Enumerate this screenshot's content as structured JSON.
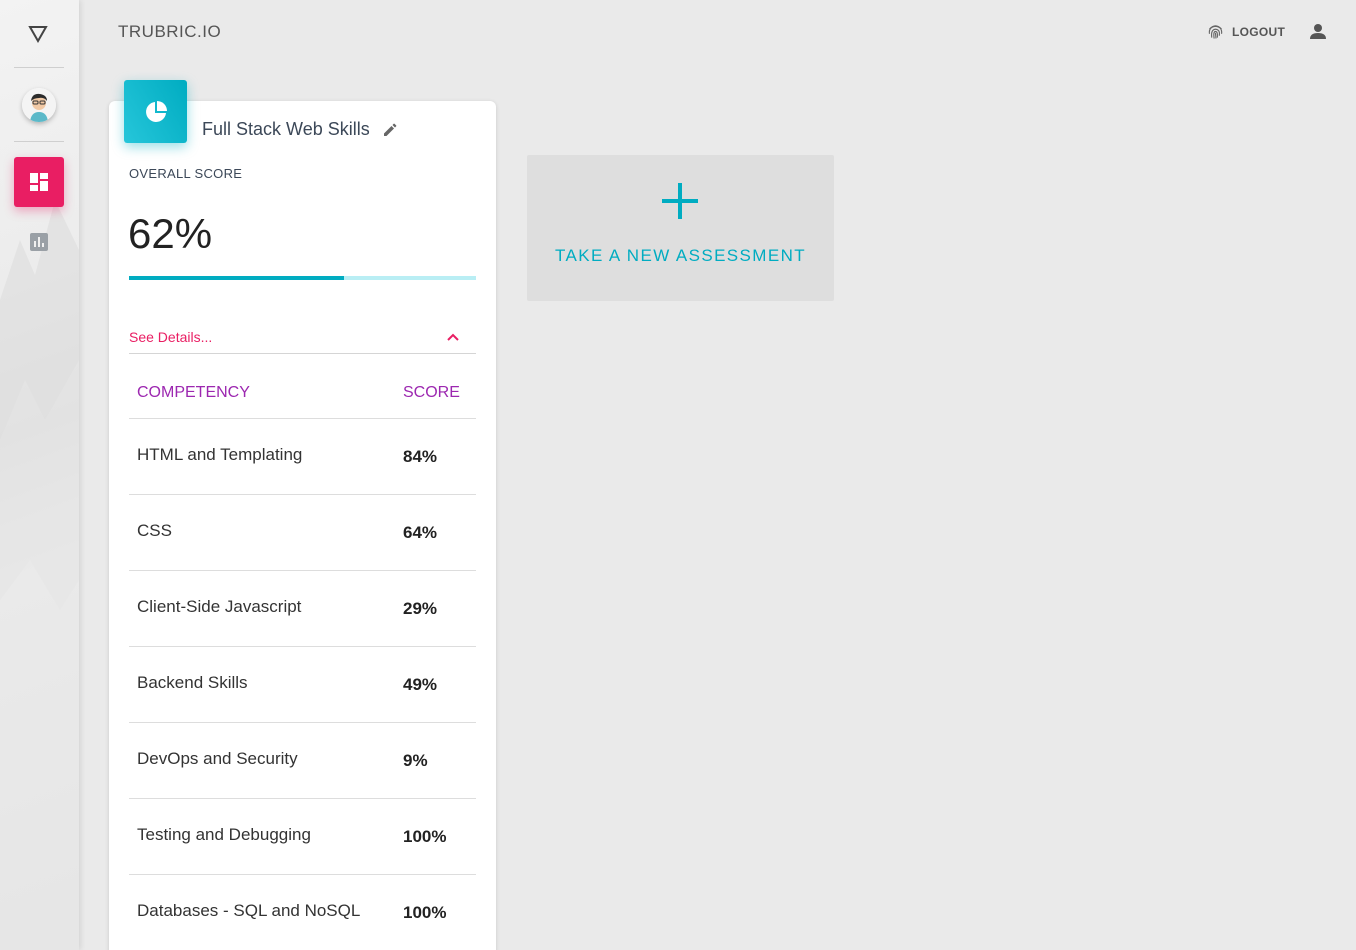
{
  "app": {
    "brand_title": "TRUBRIC.IO",
    "logout_label": "LOGOUT"
  },
  "sidebar": {
    "items": [
      {
        "name": "dashboard",
        "icon": "dashboard-icon",
        "active": true
      },
      {
        "name": "reports",
        "icon": "bar-chart-icon",
        "active": false
      }
    ]
  },
  "card": {
    "title": "Full Stack Web Skills",
    "overall_label": "OVERALL SCORE",
    "overall_value": "62%",
    "overall_fraction": 0.62,
    "details_label": "See Details...",
    "table": {
      "headers": [
        "COMPETENCY",
        "SCORE"
      ],
      "rows": [
        {
          "name": "HTML and Templating",
          "score": "84%"
        },
        {
          "name": "CSS",
          "score": "64%"
        },
        {
          "name": "Client-Side Javascript",
          "score": "29%"
        },
        {
          "name": "Backend Skills",
          "score": "49%"
        },
        {
          "name": "DevOps and Security",
          "score": "9%"
        },
        {
          "name": "Testing and Debugging",
          "score": "100%"
        },
        {
          "name": "Databases - SQL and NoSQL",
          "score": "100%"
        }
      ]
    }
  },
  "new_assessment": {
    "label": "TAKE A NEW ASSESSMENT"
  },
  "colors": {
    "accent_pink": "#e91e63",
    "accent_cyan": "#00acc1",
    "header_purple": "#9c27b0",
    "background": "#eaeaea"
  }
}
